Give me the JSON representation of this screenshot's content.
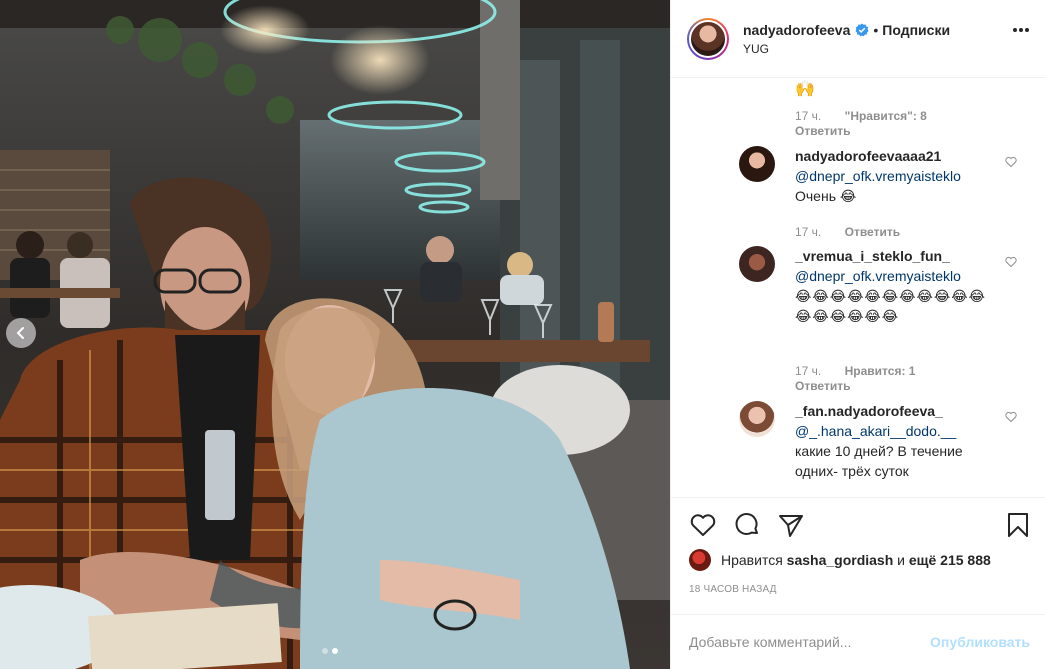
{
  "post": {
    "image_alt": "Фото",
    "carousel": {
      "count": 2,
      "active": 2
    }
  },
  "header": {
    "username": "nadyadorofeeva",
    "separator": "•",
    "follow_label": "Подписки",
    "location": "YUG"
  },
  "comments": {
    "top_emoji": "🙌",
    "top_meta": {
      "time": "17 ч.",
      "likes": "\"Нравится\": 8",
      "reply": "Ответить"
    },
    "items": [
      {
        "username": "nadyadorofeevaaaa21",
        "mention": "@dnepr_ofk.vremyaisteklo",
        "text": "Очень 😂",
        "time": "17 ч.",
        "reply": "Ответить"
      },
      {
        "username": "_vremua_i_steklo_fun_",
        "mention": "@dnepr_ofk.vremyaisteklo",
        "text": "😂😂😂😂😂😂😂😂😂😂😂😂😂😂😂😂😂",
        "time": "17 ч.",
        "likes": "Нравится: 1",
        "reply": "Ответить"
      },
      {
        "username": "_fan.nadyadorofeeva_",
        "mention": "@_.hana_akari__dodo.__",
        "text": "какие 10 дней? В течение одних- трёх суток"
      }
    ]
  },
  "likes": {
    "prefix": "Нравится",
    "user": "sasha_gordiash",
    "joiner": "и",
    "others": "ещё 215 888"
  },
  "timestamp": "18 ЧАСОВ НАЗАД",
  "add_comment": {
    "placeholder": "Добавьте комментарий...",
    "publish_label": "Опубликовать"
  },
  "colors": {
    "verified": "#3897f0",
    "mention": "#00376b",
    "publish_disabled": "#b2dffc",
    "muted": "#8e8e8e"
  },
  "icons": [
    "chevron-left-icon",
    "verified-badge-icon",
    "more-icon",
    "heart-icon",
    "comment-icon",
    "share-icon",
    "bookmark-icon"
  ]
}
